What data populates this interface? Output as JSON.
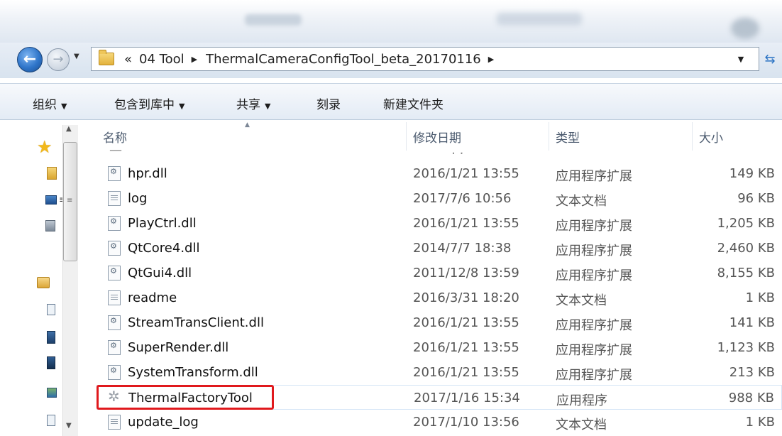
{
  "address": {
    "prefix": "«",
    "segments": [
      "04 Tool",
      "ThermalCameraConfigTool_beta_20170116"
    ]
  },
  "toolbar": {
    "organize": "组织",
    "include_library": "包含到库中",
    "share": "共享",
    "burn": "刻录",
    "new_folder": "新建文件夹"
  },
  "columns": {
    "name": "名称",
    "date": "修改日期",
    "type": "类型",
    "size": "大小"
  },
  "files": [
    {
      "name": "hpr.dll",
      "date": "2016/1/21 13:55",
      "type": "应用程序扩展",
      "size": "149 KB",
      "kind": "dll"
    },
    {
      "name": "log",
      "date": "2017/7/6 10:56",
      "type": "文本文档",
      "size": "96 KB",
      "kind": "txt"
    },
    {
      "name": "PlayCtrl.dll",
      "date": "2016/1/21 13:55",
      "type": "应用程序扩展",
      "size": "1,205 KB",
      "kind": "dll"
    },
    {
      "name": "QtCore4.dll",
      "date": "2014/7/7 18:38",
      "type": "应用程序扩展",
      "size": "2,460 KB",
      "kind": "dll"
    },
    {
      "name": "QtGui4.dll",
      "date": "2011/12/8 13:59",
      "type": "应用程序扩展",
      "size": "8,155 KB",
      "kind": "dll"
    },
    {
      "name": "readme",
      "date": "2016/3/31 18:20",
      "type": "文本文档",
      "size": "1 KB",
      "kind": "txt"
    },
    {
      "name": "StreamTransClient.dll",
      "date": "2016/1/21 13:55",
      "type": "应用程序扩展",
      "size": "141 KB",
      "kind": "dll"
    },
    {
      "name": "SuperRender.dll",
      "date": "2016/1/21 13:55",
      "type": "应用程序扩展",
      "size": "1,123 KB",
      "kind": "dll"
    },
    {
      "name": "SystemTransform.dll",
      "date": "2016/1/21 13:55",
      "type": "应用程序扩展",
      "size": "213 KB",
      "kind": "dll"
    },
    {
      "name": "ThermalFactoryTool",
      "date": "2017/1/16 15:34",
      "type": "应用程序",
      "size": "988 KB",
      "kind": "exe",
      "highlighted": true
    },
    {
      "name": "update_log",
      "date": "2017/1/10 13:56",
      "type": "文本文档",
      "size": "1 KB",
      "kind": "txt"
    }
  ],
  "icons": {
    "back": "back-arrow-icon",
    "forward": "forward-arrow-icon",
    "refresh": "refresh-icon",
    "dll": "dll-file-icon",
    "txt": "text-file-icon",
    "exe": "application-icon"
  },
  "colors": {
    "highlight_border": "#e0191d",
    "selected_row_border": "#d5e5f6"
  }
}
